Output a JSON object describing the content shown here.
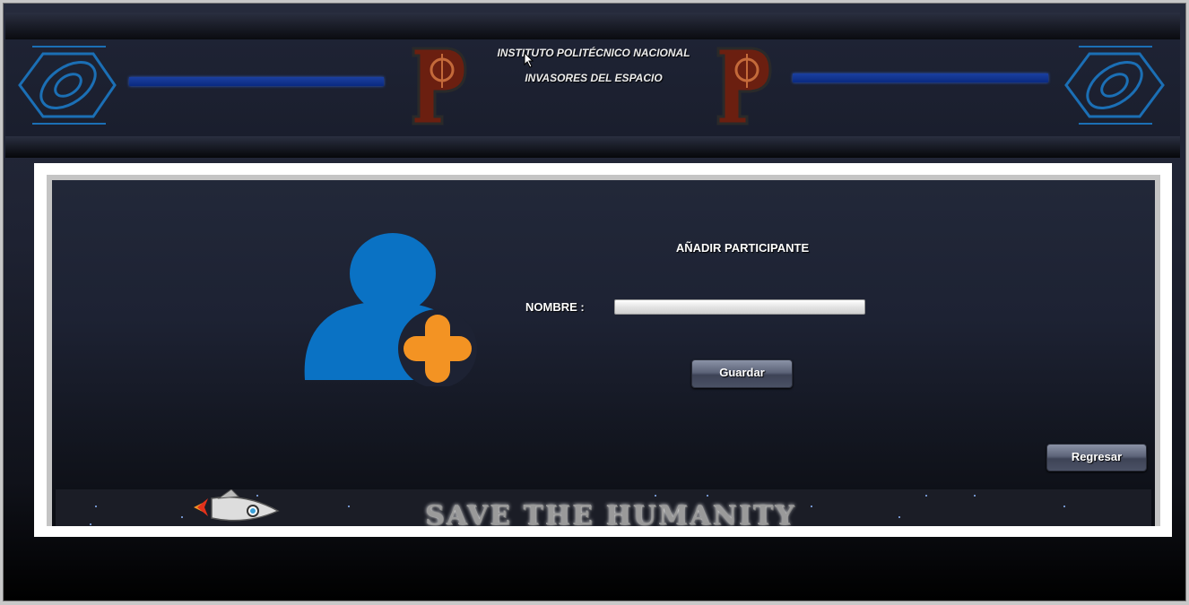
{
  "header": {
    "institution": "INSTITUTO POLITÉCNICO NACIONAL",
    "game_title": "INVASORES DEL ESPACIO"
  },
  "form": {
    "title": "AÑADIR PARTICIPANTE",
    "nombre_label": "NOMBRE :",
    "nombre_value": "",
    "save_label": "Guardar",
    "back_label": "Regresar"
  },
  "banner": {
    "text": "SAVE THE HUMANITY"
  },
  "icons": {
    "left_logo": "ipn-logo-icon",
    "right_logo": "ipn-logo-icon",
    "user": "add-user-icon",
    "rocket": "rocket-icon",
    "cursor": "mouse-cursor-icon"
  },
  "colors": {
    "user_icon": "#0a72c4",
    "plus_icon": "#f39323",
    "header_bar": "#1b3fa0"
  }
}
